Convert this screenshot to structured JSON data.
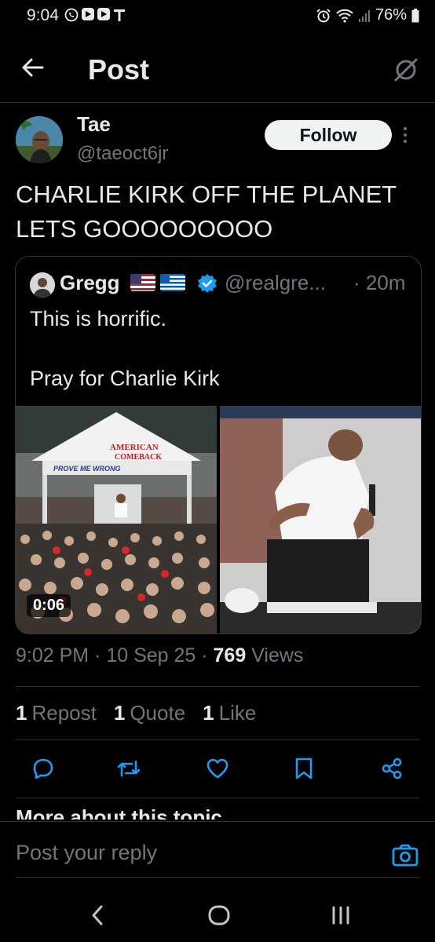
{
  "status_bar": {
    "time": "9:04",
    "battery": "76%"
  },
  "header": {
    "title": "Post"
  },
  "post": {
    "author_name": "Tae",
    "author_handle": "@taeoct6jr",
    "follow_label": "Follow",
    "text": "CHARLIE KIRK OFF THE PLANET LETS GOOOOOOOOO"
  },
  "quote": {
    "name": "Gregg",
    "handle": "@realgre...",
    "time": "· 20m",
    "text_line1": "This is horrific.",
    "text_line2": "Pray for Charlie Kirk",
    "video_duration": "0:06",
    "sign_text_1": "AMERICAN",
    "sign_text_2": "COMEBACK",
    "banner_text": "PROVE ME WRONG"
  },
  "meta": {
    "time_date": "9:02 PM · 10 Sep 25 · ",
    "views_count": "769",
    "views_label": " Views"
  },
  "stats": {
    "reposts_count": "1",
    "reposts_label": "Repost",
    "quotes_count": "1",
    "quotes_label": "Quote",
    "likes_count": "1",
    "likes_label": "Like"
  },
  "more_topics": "More about this topic",
  "reply": {
    "placeholder": "Post your reply"
  },
  "colors": {
    "background": "#000000",
    "text": "#e7e9ea",
    "muted": "#71767b",
    "accent": "#1d9bf0"
  }
}
